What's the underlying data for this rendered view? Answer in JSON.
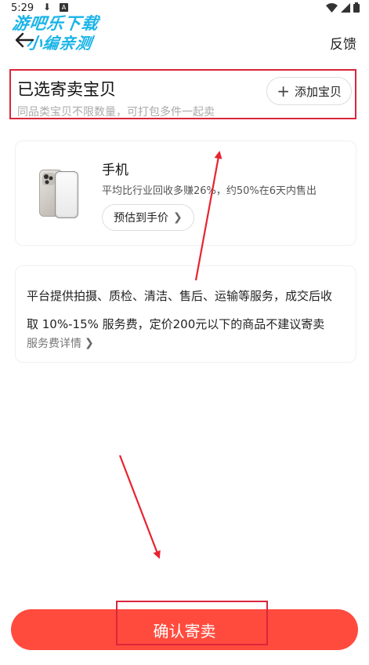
{
  "status_bar": {
    "time": "5:29",
    "download_glyph": "⬇",
    "a_glyph": "A",
    "icons": [
      "wifi-icon",
      "signal-icon",
      "battery-icon"
    ]
  },
  "watermark": {
    "line1": "游吧乐下载",
    "line2": "小编亲测"
  },
  "header": {
    "feedback_label": "反馈"
  },
  "selected": {
    "title": "已选寄卖宝贝",
    "subtitle": "同品类宝贝不限数量，可打包多件一起卖",
    "add_button": "添加宝贝"
  },
  "product": {
    "name": "手机",
    "desc": "平均比行业回收多赚26%，约50%在6天内售出",
    "estimate_button": "预估到手价"
  },
  "service": {
    "line1": "平台提供拍摄、质检、清洁、售后、运输等服务，成交后收",
    "line2": "取 10%-15% 服务费，定价200元以下的商品不建议寄卖",
    "link": "服务费详情"
  },
  "footer": {
    "confirm_label": "确认寄卖"
  },
  "colors": {
    "accent": "#ff4b3e",
    "annotation": "#d9263b",
    "watermark": "#19b4e8"
  }
}
